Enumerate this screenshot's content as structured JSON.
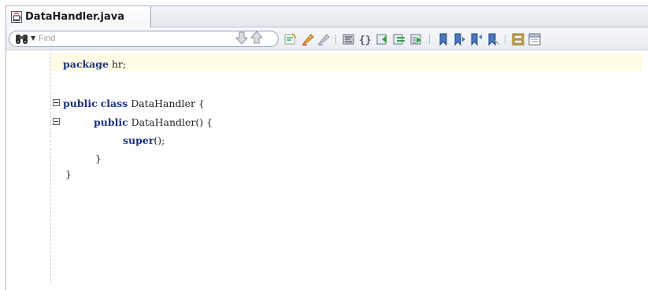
{
  "tab": {
    "title": "DataHandler.java"
  },
  "toolbar": {
    "find_placeholder": "Find"
  },
  "code": {
    "line1": {
      "kw": "package",
      "rest": " hr;"
    },
    "line2": {
      "kw1": "public",
      "kw2": "class",
      "rest": " DataHandler {"
    },
    "line3": {
      "kw": "public",
      "rest": " DataHandler() {"
    },
    "line4": {
      "kw": "super",
      "rest": "();"
    },
    "line5": "}",
    "line6": "}"
  },
  "colors": {
    "keyword": "#1a2f86",
    "current_line": "#fffbe4",
    "tab_border": "#9aa6b6"
  }
}
